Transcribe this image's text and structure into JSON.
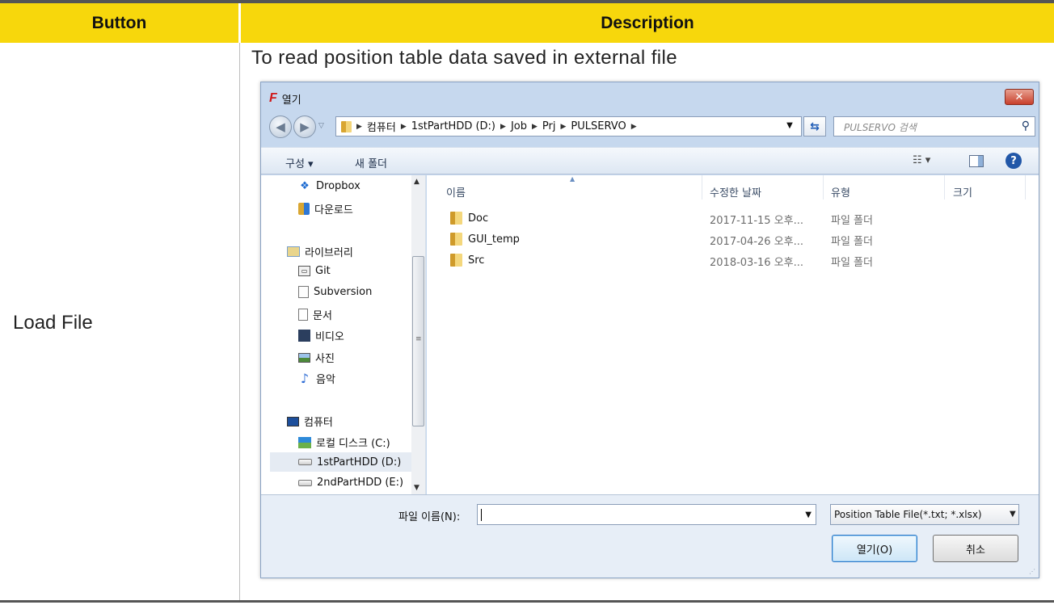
{
  "table": {
    "header_button": "Button",
    "header_description": "Description",
    "button_name": "Load File",
    "description": "To read position table data saved in external file"
  },
  "dialog": {
    "title": "열기",
    "app_icon_text": "F",
    "close_label": "✕",
    "breadcrumb": [
      "컴퓨터",
      "1stPartHDD (D:)",
      "Job",
      "Prj",
      "PULSERVO"
    ],
    "search_placeholder": "PULSERVO 검색",
    "toolbar": {
      "organize": "구성 ▾",
      "new_folder": "새 폴더",
      "view_label": "☷ ▾",
      "help": "?"
    },
    "nav_items": [
      {
        "label": "Dropbox",
        "icon": "dropbox-icon"
      },
      {
        "label": "다운로드",
        "icon": "downloads-folder-icon"
      },
      {
        "label": "라이브러리",
        "icon": "library-icon"
      },
      {
        "label": "Git",
        "icon": "git-icon"
      },
      {
        "label": "Subversion",
        "icon": "subversion-icon"
      },
      {
        "label": "문서",
        "icon": "documents-icon"
      },
      {
        "label": "비디오",
        "icon": "video-icon"
      },
      {
        "label": "사진",
        "icon": "pictures-icon"
      },
      {
        "label": "음악",
        "icon": "music-icon"
      },
      {
        "label": "컴퓨터",
        "icon": "computer-icon"
      },
      {
        "label": "로컬 디스크 (C:)",
        "icon": "local-disk-icon"
      },
      {
        "label": "1stPartHDD (D:)",
        "icon": "drive-icon",
        "selected": true
      },
      {
        "label": "2ndPartHDD (E:)",
        "icon": "drive-icon"
      }
    ],
    "columns": [
      "이름",
      "수정한 날짜",
      "유형",
      "크기"
    ],
    "files": [
      {
        "name": "Doc",
        "date": "2017-11-15 오후...",
        "type": "파일 폴더"
      },
      {
        "name": "GUI_temp",
        "date": "2017-04-26 오후...",
        "type": "파일 폴더"
      },
      {
        "name": "Src",
        "date": "2018-03-16 오후...",
        "type": "파일 폴더"
      }
    ],
    "filename_label": "파일 이름(N):",
    "filename_value": "",
    "file_type": "Position Table File(*.txt; *.xlsx)",
    "open_button": "열기(O)",
    "cancel_button": "취소"
  }
}
